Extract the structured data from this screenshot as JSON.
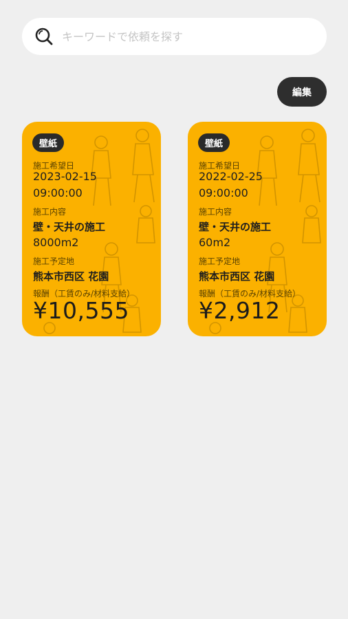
{
  "search": {
    "placeholder": "キーワードで依頼を探す"
  },
  "toolbar": {
    "edit_label": "編集"
  },
  "cards": [
    {
      "badge": "壁紙",
      "date_label": "施工希望日",
      "date": "2023-02-15",
      "time": "09:00:00",
      "content_label": "施工内容",
      "content": "壁・天井の施工",
      "area": "8000m2",
      "location_label": "施工予定地",
      "location": "熊本市西区 花園",
      "reward_label": "報酬（工賃のみ/材料支給）",
      "price": "¥10,555"
    },
    {
      "badge": "壁紙",
      "date_label": "施工希望日",
      "date": "2022-02-25",
      "time": "09:00:00",
      "content_label": "施工内容",
      "content": "壁・天井の施工",
      "area": "60m2",
      "location_label": "施工予定地",
      "location": "熊本市西区 花園",
      "reward_label": "報酬（工賃のみ/材料支給）",
      "price": "¥2,912"
    }
  ],
  "colors": {
    "card": "#fbb100",
    "badge": "#2a2a2a",
    "edit_button": "#2e2e2e",
    "background": "#efefef"
  },
  "icons": {
    "search": "search-icon",
    "card_background": "worker-illustration-pattern"
  }
}
